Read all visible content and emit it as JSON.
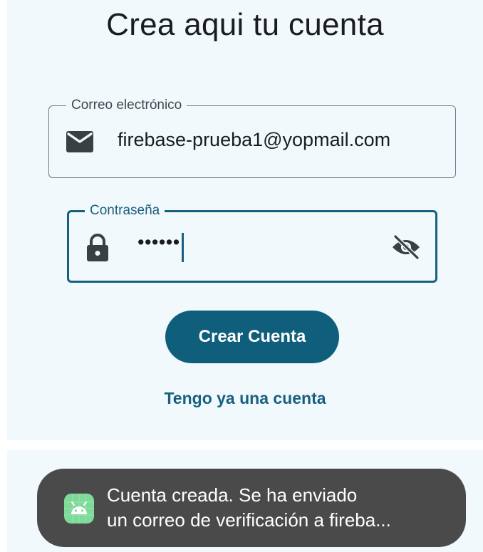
{
  "screen": {
    "title": "Crea aqui tu cuenta"
  },
  "email_field": {
    "label": "Correo electrónico",
    "value": "firebase-prueba1@yopmail.com",
    "icon": "mail-icon"
  },
  "password_field": {
    "label": "Contraseña",
    "value": "••••••",
    "icon": "lock-icon",
    "toggle_icon": "visibility-off-icon"
  },
  "create_button": {
    "label": "Crear Cuenta"
  },
  "login_link": {
    "label": "Tengo ya una cuenta"
  },
  "toast": {
    "line1": "Cuenta creada. Se ha enviado",
    "line2": "un correo de verificación a fireba...",
    "icon": "android-app-icon"
  },
  "colors": {
    "primary": "#0f5f7c",
    "background": "#f1f9fc",
    "toast_bg": "#4a4a4a",
    "icon_dark": "#3a3f44"
  }
}
